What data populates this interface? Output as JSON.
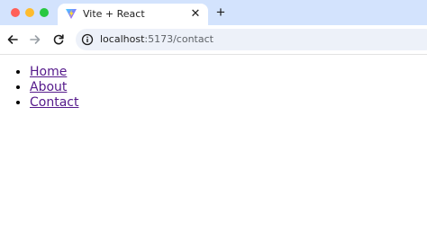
{
  "browser": {
    "tab": {
      "title": "Vite + React",
      "favicon": "vite-logo-icon",
      "close_glyph": "✕"
    },
    "new_tab_glyph": "+",
    "address_bar": {
      "host": "localhost",
      "path": ":5173/contact",
      "site_info_icon": "info-icon"
    },
    "nav_icons": [
      "back-arrow-icon",
      "forward-arrow-icon",
      "reload-icon"
    ]
  },
  "page": {
    "nav_links": [
      {
        "label": "Home"
      },
      {
        "label": "About"
      },
      {
        "label": "Contact"
      }
    ]
  },
  "colors": {
    "tabstrip": "#d3e3fd",
    "omnibox": "#edf1f9",
    "visited_link": "#551a8b"
  }
}
